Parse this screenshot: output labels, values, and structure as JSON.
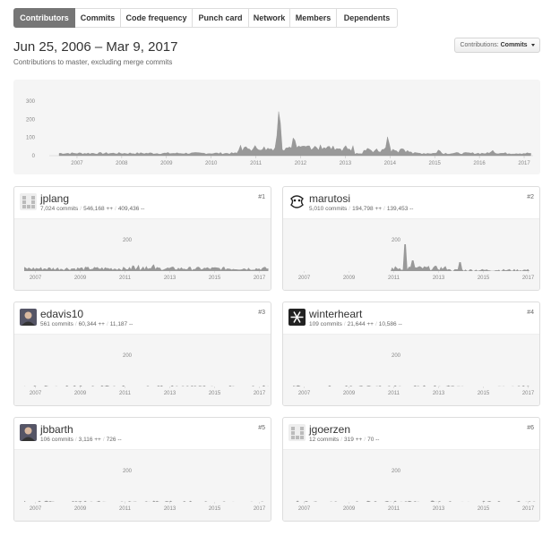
{
  "tabs": [
    {
      "label": "Contributors",
      "selected": true
    },
    {
      "label": "Commits",
      "selected": false
    },
    {
      "label": "Code frequency",
      "selected": false
    },
    {
      "label": "Punch card",
      "selected": false
    },
    {
      "label": "Network",
      "selected": false
    },
    {
      "label": "Members",
      "selected": false
    },
    {
      "label": "Dependents",
      "selected": false
    }
  ],
  "header": {
    "title": "Jun 25, 2006 – Mar 9, 2017",
    "subtitle": "Contributions to master, excluding merge commits",
    "select_prefix": "Contributions:",
    "select_value": "Commits"
  },
  "colors": {
    "area": "#999999",
    "chart_bg": "#f5f5f5",
    "tab_selected": "#767676"
  },
  "chart_data": [
    {
      "type": "area",
      "yticks": [
        "0",
        "100",
        "200",
        "300"
      ],
      "xticks": [
        "2007",
        "2008",
        "2009",
        "2010",
        "2011",
        "2012",
        "2013",
        "2014",
        "2015",
        "2016",
        "2017"
      ],
      "ylim": [
        0,
        300
      ],
      "peaks": [
        {
          "x": 2011.52,
          "y": 275
        },
        {
          "x": 2011.85,
          "y": 110
        },
        {
          "x": 2012.1,
          "y": 60
        },
        {
          "x": 2012.45,
          "y": 55
        },
        {
          "x": 2013.95,
          "y": 105
        },
        {
          "x": 2015.1,
          "y": 35
        },
        {
          "x": 2016.3,
          "y": 30
        }
      ]
    }
  ],
  "contributors": [
    {
      "name": "jplang",
      "commits": "7,024 commits",
      "additions": "546,168 ++",
      "deletions": "409,436 --",
      "rank": "#1",
      "avatar_icon": "identicon-grey-icon",
      "chart": {
        "ymax_label": "200",
        "xticks": [
          "2007",
          "2009",
          "2011",
          "2013",
          "2015",
          "2017"
        ],
        "level": "dense-low"
      }
    },
    {
      "name": "marutosi",
      "commits": "5,010 commits",
      "additions": "194,798 ++",
      "deletions": "139,453 --",
      "rank": "#2",
      "avatar_icon": "cartoon-avatar-icon",
      "chart": {
        "ymax_label": "200",
        "xticks": [
          "2007",
          "2009",
          "2011",
          "2013",
          "2015",
          "2017"
        ],
        "level": "spike-2011"
      }
    },
    {
      "name": "edavis10",
      "commits": "561 commits",
      "additions": "60,344 ++",
      "deletions": "11,187 --",
      "rank": "#3",
      "avatar_icon": "photo-avatar-icon",
      "chart": {
        "ymax_label": "200",
        "xticks": [
          "2007",
          "2009",
          "2011",
          "2013",
          "2015",
          "2017"
        ],
        "level": "sparse"
      }
    },
    {
      "name": "winterheart",
      "commits": "109 commits",
      "additions": "21,644 ++",
      "deletions": "10,586 --",
      "rank": "#4",
      "avatar_icon": "snowflake-avatar-icon",
      "chart": {
        "ymax_label": "200",
        "xticks": [
          "2007",
          "2009",
          "2011",
          "2013",
          "2015",
          "2017"
        ],
        "level": "sparse"
      }
    },
    {
      "name": "jbbarth",
      "commits": "106 commits",
      "additions": "3,116 ++",
      "deletions": "726 --",
      "rank": "#5",
      "avatar_icon": "photo-avatar-icon",
      "chart": {
        "ymax_label": "200",
        "xticks": [
          "2007",
          "2009",
          "2011",
          "2013",
          "2015",
          "2017"
        ],
        "level": "sparse"
      }
    },
    {
      "name": "jgoerzen",
      "commits": "12 commits",
      "additions": "319 ++",
      "deletions": "70 --",
      "rank": "#6",
      "avatar_icon": "identicon-grey-icon",
      "chart": {
        "ymax_label": "200",
        "xticks": [
          "2007",
          "2009",
          "2011",
          "2013",
          "2015",
          "2017"
        ],
        "level": "sparse"
      }
    }
  ]
}
